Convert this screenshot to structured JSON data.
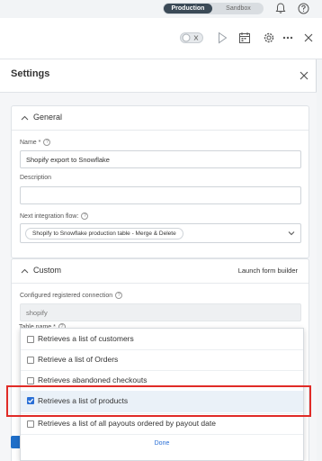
{
  "env": {
    "production": "Production",
    "sandbox": "Sandbox"
  },
  "panel": {
    "title": "Settings"
  },
  "general": {
    "title": "General",
    "name_label": "Name *",
    "name_value": "Shopify export to Snowflake",
    "description_label": "Description",
    "description_value": "",
    "next_flow_label": "Next integration flow:",
    "next_flow_chip": "Shopify to Snowflake production table - Merge & Delete"
  },
  "custom": {
    "title": "Custom",
    "launch_link": "Launch form builder",
    "connection_label": "Configured registered connection",
    "connection_value": "shopify",
    "table_label_peek": "Table name *"
  },
  "dropdown": {
    "options": [
      {
        "label": "Retrieves a list of customers",
        "checked": false
      },
      {
        "label": "Retrieve a list of Orders",
        "checked": false
      },
      {
        "label": "Retrieves abandoned checkouts",
        "checked": false
      },
      {
        "label": "Retrieves a list of products",
        "checked": true
      },
      {
        "label": "Retrieves a list of all payouts ordered by payout date",
        "checked": false
      }
    ],
    "done_label": "Done"
  },
  "colors": {
    "accent": "#2a6fd6",
    "highlight": "#e02b27",
    "env_active": "#3b4a57"
  }
}
